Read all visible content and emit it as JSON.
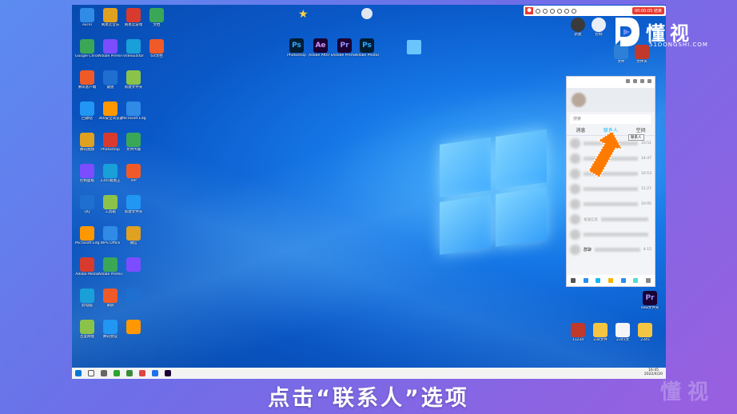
{
  "brand": {
    "name": "懂视",
    "url": "51DONGSHI.COM"
  },
  "caption": "点击“联系人”选项",
  "desktop_left_labels": [
    [
      "excel",
      "网易云音乐",
      "网易云游戏",
      "文档"
    ],
    [
      "Google Chrome",
      "Adobe Premiere",
      "VideoEditor",
      "txt文档"
    ],
    [
      "腾讯客户端",
      "键盘",
      "新建文件夹",
      ""
    ],
    [
      "回收站",
      "360安全浏览器",
      "Microsoft Edge",
      ""
    ],
    [
      "腾讯视频",
      "Photoshop",
      "文件传输",
      ""
    ],
    [
      "控制面板",
      "2345看图王",
      "VIP",
      ""
    ],
    [
      "QQ",
      "工具箱",
      "新建文件夹",
      ""
    ],
    [
      "Microsoft Edge",
      "WPS Office",
      "微信",
      ""
    ],
    [
      "Adobe Media",
      "Adobe Premiere Pro",
      "",
      ""
    ],
    [
      "此电脑",
      "录屏",
      "",
      ""
    ],
    [
      "百度网盘",
      "腾讯会议",
      "",
      ""
    ]
  ],
  "desktop_center_labels": [
    "Photoshop",
    "Adobe After Effects 2019",
    "Adobe Premiere",
    "Adobe Photoshop"
  ],
  "desktop_right_top": [
    "新建",
    "控制",
    "文件",
    "文件夹"
  ],
  "desktop_right_bottom": [
    "11234",
    "234文件",
    "2345文",
    "2345"
  ],
  "pr_icon_label": "new文件夹",
  "recorder": {
    "button": "00:00:05 结束"
  },
  "qq": {
    "search_placeholder": "搜索",
    "tabs": [
      "消息",
      "联系人",
      "空间"
    ],
    "tooltip": "联系人",
    "rows": [
      {
        "time": "10:51"
      },
      {
        "time": "14:47"
      },
      {
        "time": "10:53"
      },
      {
        "time": "11:27"
      },
      {
        "time": "10:05"
      },
      {
        "time": "",
        "note": "发送信息"
      },
      {
        "time": ""
      },
      {
        "time": "4-15",
        "name": "群聊"
      }
    ]
  },
  "taskbar": {
    "date_line1": "16:45",
    "date_line2": "2022/4/20"
  },
  "colors": {
    "accent": "#12b7f5",
    "arrow": "#ff7a00",
    "record": "#e8392f"
  }
}
